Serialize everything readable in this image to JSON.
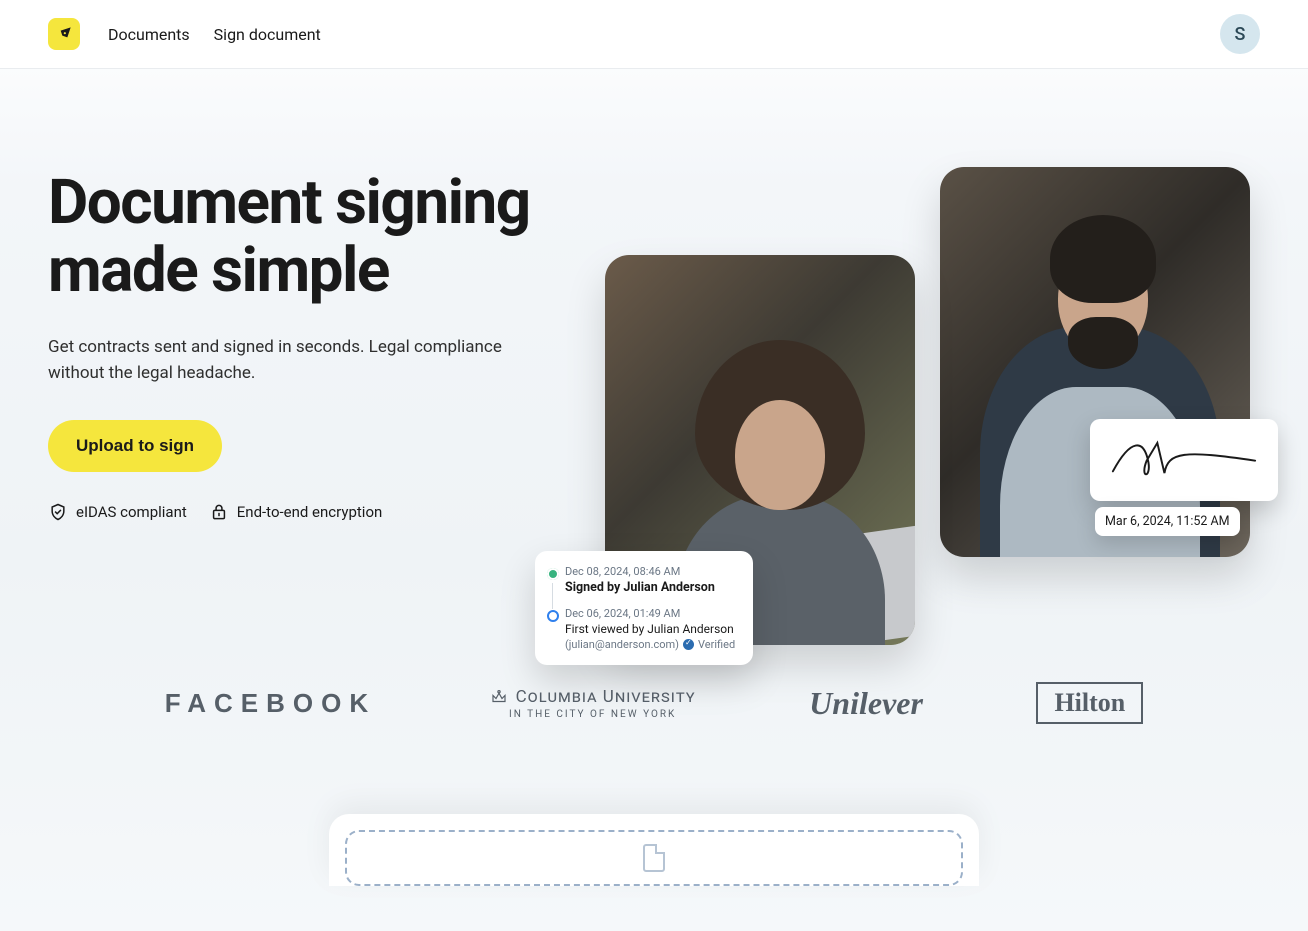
{
  "header": {
    "nav": {
      "documents": "Documents",
      "sign": "Sign document"
    },
    "avatar_initial": "S"
  },
  "hero": {
    "title": "Document signing made simple",
    "subhead": "Get contracts sent and signed in seconds. Legal compliance without the legal headache.",
    "cta": "Upload to sign",
    "badges": {
      "eidas": "eIDAS compliant",
      "e2e": "End-to-end encryption"
    }
  },
  "signature": {
    "timestamp": "Mar 6, 2024, 11:52 AM"
  },
  "audit": {
    "items": [
      {
        "state": "done",
        "date": "Dec 08, 2024, 08:46 AM",
        "title": "Signed by Julian Anderson"
      },
      {
        "state": "view",
        "date": "Dec 06, 2024, 01:49 AM",
        "title": "First viewed by Julian Anderson",
        "email": "(julian@anderson.com)",
        "verified": "Verified"
      }
    ]
  },
  "logos": {
    "facebook": "FACEBOOK",
    "columbia_top": "Columbia University",
    "columbia_bot": "IN THE CITY OF NEW YORK",
    "unilever": "Unilever",
    "hilton": "Hilton"
  }
}
